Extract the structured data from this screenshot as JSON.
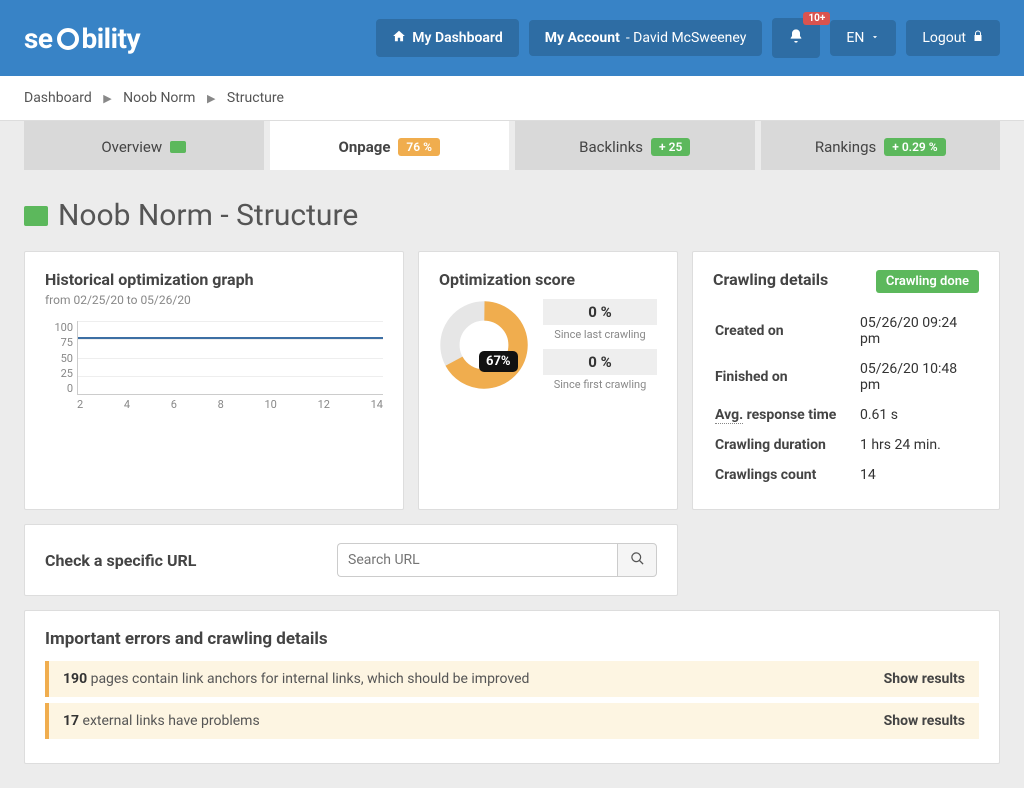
{
  "header": {
    "logo_text": "seobility",
    "my_dashboard": "My Dashboard",
    "my_account": "My Account",
    "account_user": "- David McSweeney",
    "notif_count": "10+",
    "lang": "EN",
    "logout": "Logout"
  },
  "breadcrumb": {
    "items": [
      "Dashboard",
      "Noob Norm",
      "Structure"
    ]
  },
  "tabs": [
    {
      "label": "Overview",
      "badge": null,
      "icon": true,
      "active": false
    },
    {
      "label": "Onpage",
      "badge": "76 %",
      "badge_cls": "orange",
      "active": true
    },
    {
      "label": "Backlinks",
      "badge": "+ 25",
      "badge_cls": "green",
      "active": false
    },
    {
      "label": "Rankings",
      "badge": "+ 0.29 %",
      "badge_cls": "green",
      "active": false
    }
  ],
  "page_title": "Noob Norm - Structure",
  "hist": {
    "title": "Historical optimization graph",
    "sub": "from 02/25/20 to 05/26/20"
  },
  "score": {
    "title": "Optimization score",
    "center": "67%",
    "deltas": [
      {
        "val": "0 %",
        "lbl": "Since last crawling"
      },
      {
        "val": "0 %",
        "lbl": "Since first crawling"
      }
    ]
  },
  "crawl": {
    "title": "Crawling details",
    "status": "Crawling done",
    "rows": [
      {
        "k": "Created on",
        "v": "05/26/20 09:24 pm"
      },
      {
        "k": "Finished on",
        "v": "05/26/20 10:48 pm"
      },
      {
        "k": "Avg. response time",
        "v": "0.61 s",
        "dotted": true
      },
      {
        "k": "Crawling duration",
        "v": "1 hrs 24 min."
      },
      {
        "k": "Crawlings count",
        "v": "14"
      }
    ]
  },
  "url_check": {
    "title": "Check a specific URL",
    "placeholder": "Search URL"
  },
  "errors": {
    "title": "Important errors and crawling details",
    "show": "Show results",
    "rows": [
      {
        "num": "190",
        "text": " pages contain link anchors for internal links, which should be improved"
      },
      {
        "num": "17",
        "text": " external links have problems"
      }
    ]
  },
  "chart_data": {
    "type": "line",
    "title": "Historical optimization graph",
    "xlabel": "",
    "ylabel": "",
    "x": [
      2,
      4,
      6,
      8,
      10,
      12,
      14
    ],
    "ylim": [
      0,
      100
    ],
    "yticks": [
      0,
      25,
      50,
      75,
      100
    ],
    "series": [
      {
        "name": "Optimization score",
        "values": [
          76,
          76,
          76,
          76,
          76,
          76,
          76
        ]
      }
    ],
    "donut": {
      "value": 67,
      "max": 100
    }
  }
}
